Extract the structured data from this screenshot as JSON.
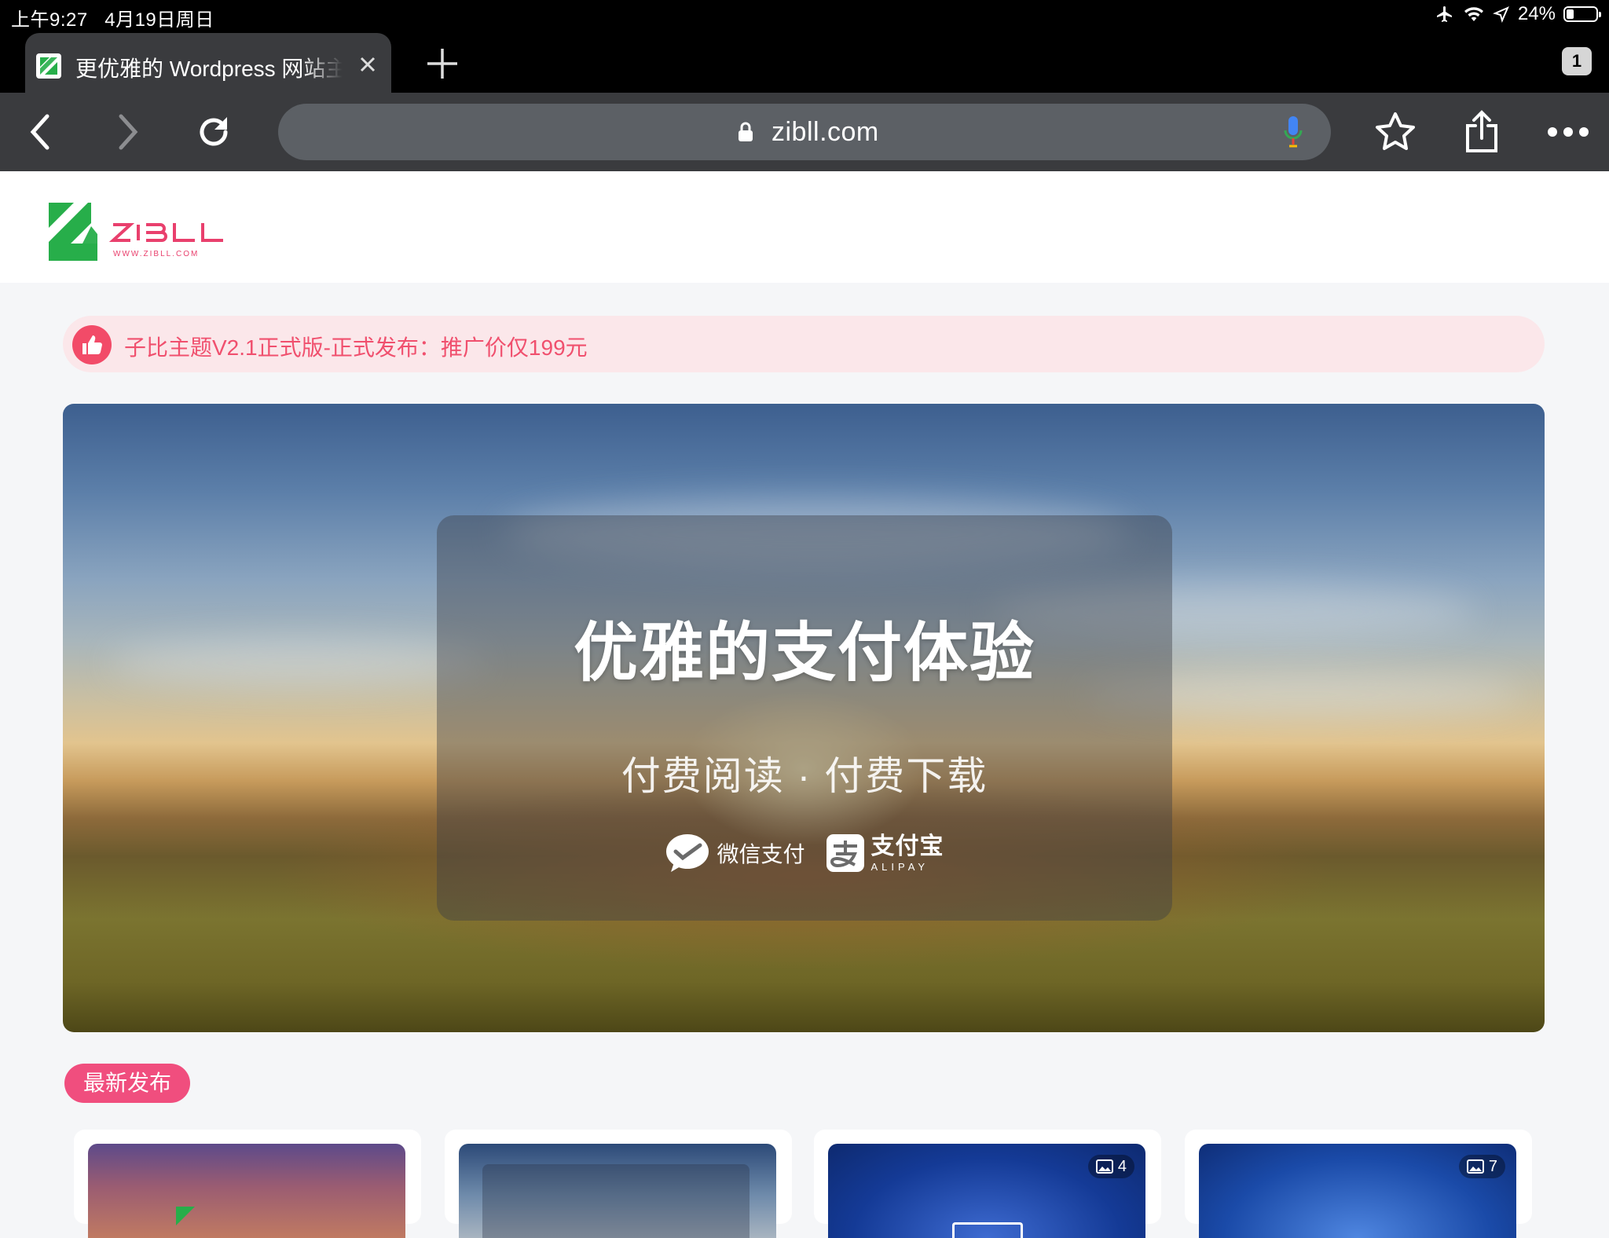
{
  "status_bar": {
    "time": "上午9:27",
    "date": "4月19日周日",
    "battery": "24%",
    "battery_level": 0.24
  },
  "tabs": {
    "active_title": "更优雅的 Wordpress 网站主",
    "count": "1"
  },
  "address_bar": {
    "url": "zibll.com"
  },
  "site": {
    "logo_text": "ZIBLL",
    "logo_subtext": "WWW.ZIBLL.COM"
  },
  "notice": {
    "text": "子比主题V2.1正式版-正式发布：推广价仅199元"
  },
  "hero": {
    "title": "优雅的支付体验",
    "subtitle": "付费阅读 · 付费下载",
    "wechat_pay_label": "微信支付",
    "alipay_label": "支付宝",
    "alipay_en": "ALIPAY"
  },
  "section": {
    "latest_label": "最新发布"
  },
  "cards": [
    {
      "image_count": ""
    },
    {
      "image_count": ""
    },
    {
      "image_count": "4"
    },
    {
      "image_count": "7"
    }
  ],
  "colors": {
    "accent_pink": "#f04e7e",
    "notice_bg": "#fbe7ea",
    "logo_green": "#27ae4a",
    "toolbar": "#3a3b3e"
  }
}
